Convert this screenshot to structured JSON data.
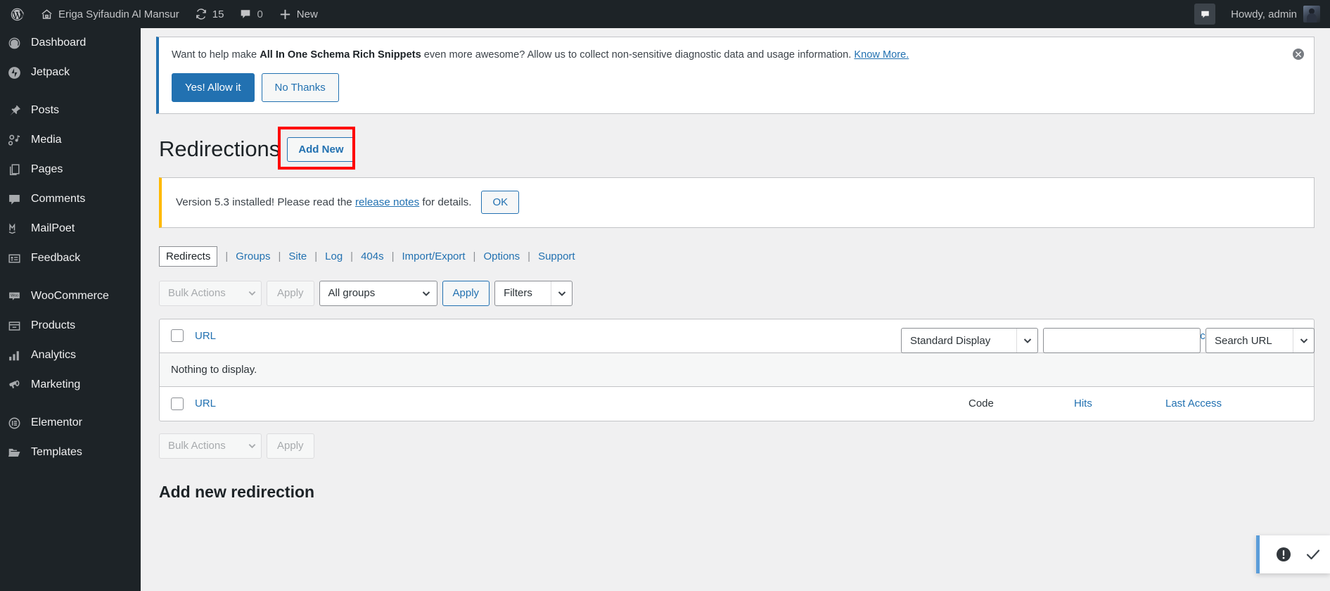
{
  "adminbar": {
    "wp_logo_icon": "wordpress-logo-icon",
    "home_icon": "home-icon",
    "site_name": "Eriga Syifaudin Al Mansur",
    "updates_icon": "updates-icon",
    "updates_count": "15",
    "comments_icon": "comment-bubble-icon",
    "comments_count": "0",
    "new_icon": "plus-icon",
    "new_label": "New",
    "notifications_icon": "comment-bubble-icon",
    "howdy_label": "Howdy, admin",
    "avatar": "avatar"
  },
  "sidebar": {
    "items": [
      {
        "label": "Dashboard",
        "icon": "dashboard-icon",
        "sep_after": false
      },
      {
        "label": "Jetpack",
        "icon": "jetpack-icon",
        "sep_after": true
      },
      {
        "label": "Posts",
        "icon": "pin-icon",
        "sep_after": false
      },
      {
        "label": "Media",
        "icon": "media-icon",
        "sep_after": false
      },
      {
        "label": "Pages",
        "icon": "pages-icon",
        "sep_after": false
      },
      {
        "label": "Comments",
        "icon": "comment-bubble-icon",
        "sep_after": false
      },
      {
        "label": "MailPoet",
        "icon": "mailpoet-icon",
        "sep_after": false
      },
      {
        "label": "Feedback",
        "icon": "feedback-icon",
        "sep_after": true
      },
      {
        "label": "WooCommerce",
        "icon": "woocommerce-icon",
        "sep_after": false
      },
      {
        "label": "Products",
        "icon": "products-icon",
        "sep_after": false
      },
      {
        "label": "Analytics",
        "icon": "analytics-icon",
        "sep_after": false
      },
      {
        "label": "Marketing",
        "icon": "marketing-megaphone-icon",
        "sep_after": true
      },
      {
        "label": "Elementor",
        "icon": "elementor-icon",
        "sep_after": false
      },
      {
        "label": "Templates",
        "icon": "folder-icon",
        "sep_after": false
      }
    ]
  },
  "schema_notice": {
    "text_before": "Want to help make ",
    "plugin_name": "All In One Schema Rich Snippets",
    "text_after": " even more awesome? Allow us to collect non-sensitive diagnostic data and usage information. ",
    "link_label": "Know More.",
    "allow_label": "Yes! Allow it",
    "decline_label": "No Thanks",
    "dismiss_icon": "close-circle-icon"
  },
  "page": {
    "title": "Redirections",
    "add_new_label": "Add New",
    "highlight_color": "#ff0000"
  },
  "version_notice": {
    "text_before": "Version 5.3 installed! Please read the ",
    "link_label": "release notes",
    "text_after": " for details.",
    "ok_label": "OK"
  },
  "tabs": {
    "current": "Redirects",
    "items": [
      {
        "label": "Redirects",
        "current": true
      },
      {
        "label": "Groups",
        "current": false
      },
      {
        "label": "Site",
        "current": false
      },
      {
        "label": "Log",
        "current": false
      },
      {
        "label": "404s",
        "current": false
      },
      {
        "label": "Import/Export",
        "current": false
      },
      {
        "label": "Options",
        "current": false
      },
      {
        "label": "Support",
        "current": false
      }
    ],
    "separator": "|"
  },
  "search_row": {
    "display_select_value": "Standard Display",
    "search_value": "",
    "search_placeholder": "",
    "search_type_value": "Search URL",
    "chevron_icon": "chevron-down-icon"
  },
  "tablenav_top": {
    "bulk_actions_label": "Bulk Actions",
    "apply_label": "Apply",
    "groups_label": "All groups",
    "apply2_label": "Apply",
    "filters_label": "Filters",
    "chevron_icon": "chevron-down-icon"
  },
  "table": {
    "columns": [
      {
        "key": "url",
        "label": "URL",
        "sortable": true
      },
      {
        "key": "code",
        "label": "Code",
        "sortable": false
      },
      {
        "key": "hits",
        "label": "Hits",
        "sortable": true
      },
      {
        "key": "last_access",
        "label": "Last Access",
        "sortable": true
      }
    ],
    "rows": [],
    "empty_message": "Nothing to display.",
    "checkbox_icon": "checkbox-icon"
  },
  "tablenav_bottom": {
    "bulk_actions_label": "Bulk Actions",
    "apply_label": "Apply",
    "chevron_icon": "chevron-down-icon"
  },
  "add_new_section": {
    "heading": "Add new redirection"
  },
  "toast": {
    "warning_icon": "exclamation-circle-icon",
    "check_icon": "checkmark-icon",
    "accent_color": "#5b9dd9"
  }
}
